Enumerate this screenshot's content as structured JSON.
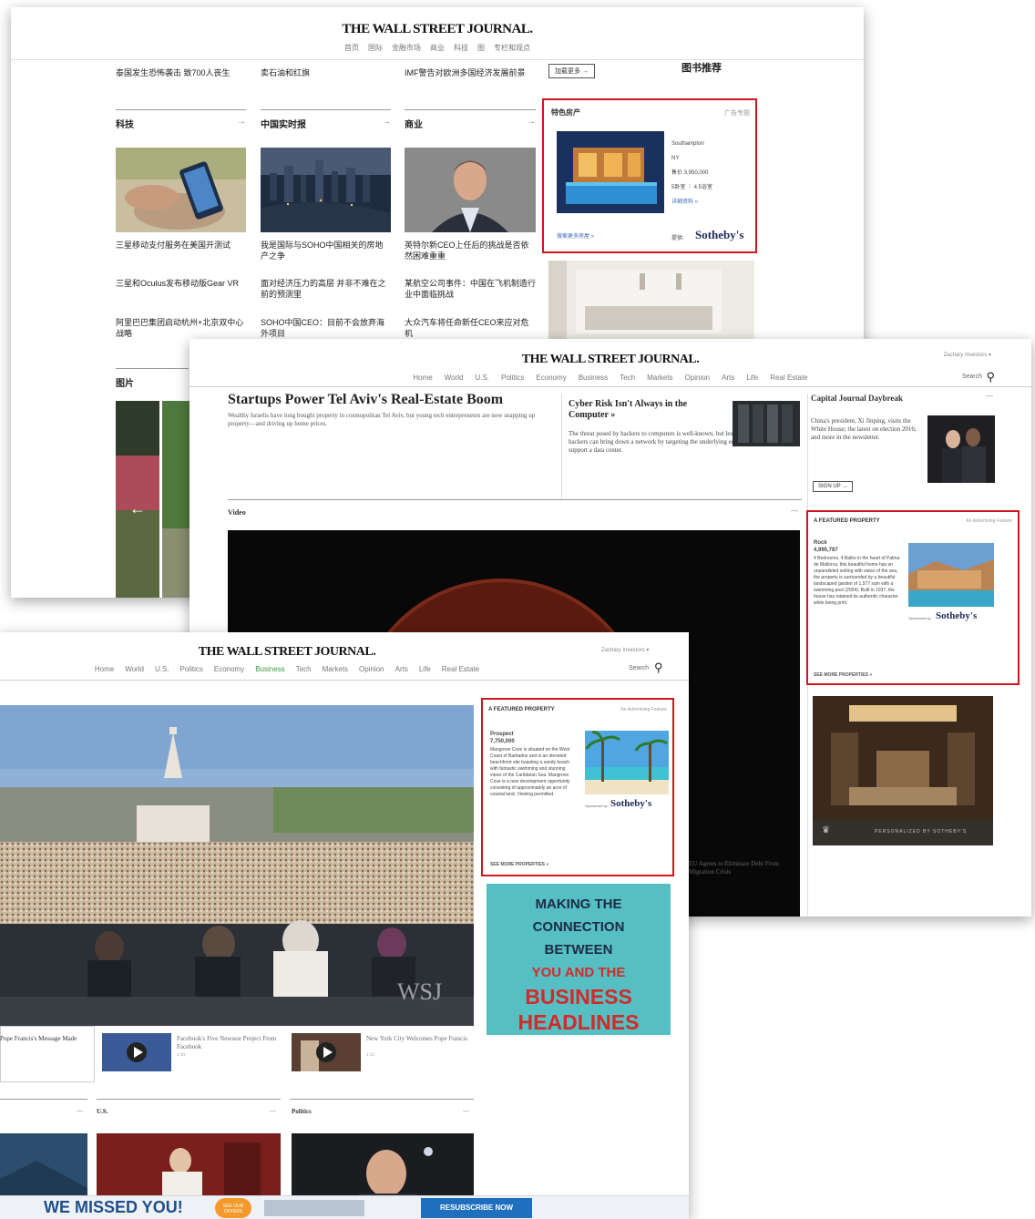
{
  "colors": {
    "accent_red": "#d0161e",
    "wsj_blue": "#3a6ab8",
    "ad_teal": "#56bfc3",
    "ad_red": "#d22a2a",
    "sothebys_navy": "#1b2a58"
  },
  "panel1": {
    "logo": "THE WALL STREET JOURNAL.",
    "nav": [
      "首页",
      "国际",
      "金融市场",
      "商业",
      "科技",
      "图",
      "专栏和观点"
    ],
    "top_snippets": [
      "泰国发生恐怖袭击 致700人丧生",
      "卖石油和红旗",
      "IMF警告对欧洲多国经济发展前景",
      "加载更多 →",
      "图书推荐"
    ],
    "columns": [
      {
        "head": "科技",
        "items": [
          "三星移动支付服务在美国开测试",
          "三星和Oculus发布移动版Gear VR",
          "阿里巴巴集团启动杭州+北京双中心战略"
        ]
      },
      {
        "head": "中国实时报",
        "items": [
          "我是国际与SOHO中国相关的房地产之争",
          "面对经济压力的高层 并非不难在之前的预测里",
          "SOHO中国CEO：目前不会放弃海外项目"
        ]
      },
      {
        "head": "商业",
        "items": [
          "英特尔新CEO上任后的挑战是否依然困难重重",
          "某航空公司事件：中国在飞机制造行业中面临挑战",
          "大众汽车将任命新任CEO来应对危机"
        ]
      }
    ],
    "photos_head": "图片",
    "featured": {
      "head": "特色房产",
      "tag": "广告专题",
      "city": "Southampton",
      "state": "NY",
      "price": "售价 3,950,000",
      "rooms": "5卧室 ｜ 4.5浴室",
      "details_link": "详细资料 »",
      "more_link": "搜索更多房屋 »",
      "agency_prefix": "提供:",
      "agency": "Sotheby's"
    }
  },
  "panel2": {
    "logo": "THE WALL STREET JOURNAL.",
    "account": "Zachary Investors ▾",
    "nav": [
      "Home",
      "World",
      "U.S.",
      "Politics",
      "Economy",
      "Business",
      "Tech",
      "Markets",
      "Opinion",
      "Arts",
      "Life",
      "Real Estate"
    ],
    "search": "Search",
    "headline": "Startups Power Tel Aviv's Real-Estate Boom",
    "deck": "Wealthy Israelis have long bought property in cosmopolitan Tel Aviv, but young tech entrepreneurs are now snapping up property—and driving up home prices.",
    "side_headline": "Cyber Risk Isn't Always in the Computer »",
    "side_deck": "The threat posed by hackers to computers is well-known, but less understood is how hackers can bring down a network by targeting the underlying equipment that support a data center.",
    "video_label": "Video",
    "capital_journal": {
      "head": "Capital Journal Daybreak",
      "text": "China's president, Xi Jinping, visits the White House; the latest on election 2016; and more in the newsletter.",
      "signup": "SIGN UP →"
    },
    "featured": {
      "head": "A FEATURED PROPERTY",
      "tag": "An Advertising Feature",
      "place": "Rock",
      "price": "4,995,787",
      "desc": "4 Bedrooms, 4 Baths in the heart of Palma de Mallorca, this beautiful home has an unparalleled setting with views of the sea, the property is surrounded by a beautiful landscaped garden of 1,577 sqm with a swimming pool (2004). Built in 1937, the house has retained its authentic character while being prim.",
      "more": "SEE MORE PROPERTIES »",
      "sponsor": "Sponsored by",
      "agency": "Sotheby's"
    },
    "ad_caption": "PERSONALIZED BY SOTHEBY'S",
    "video_caption": "EU Agrees to Eliminate Debt From Migration Crisis"
  },
  "panel3": {
    "logo": "THE WALL STREET JOURNAL.",
    "account": "Zachary Investors ▾",
    "nav": [
      "Home",
      "World",
      "U.S.",
      "Politics",
      "Economy",
      "Business",
      "Tech",
      "Markets",
      "Opinion",
      "Arts",
      "Life",
      "Real Estate"
    ],
    "search": "Search",
    "watermark": "WSJ",
    "featured": {
      "head": "A FEATURED PROPERTY",
      "tag": "An Advertising Feature",
      "place": "Prospect",
      "price": "7,750,000",
      "desc": "Mangrove Cove is situated on the West Coast of Barbados and is an elevated beachfront site boasting a sandy beach with fantastic swimming and stunning views of the Caribbean Sea. Mangrove Cove is a new development opportunity consisting of approximately an acre of coastal land. Viewing permitted.",
      "more": "SEE MORE PROPERTIES »",
      "sponsor": "Sponsored by",
      "agency": "Sotheby's"
    },
    "ad_lines": [
      "MAKING THE",
      "CONNECTION",
      "BETWEEN",
      "YOU AND THE"
    ],
    "ad_big": [
      "BUSINESS",
      "HEADLINES"
    ],
    "thumbs": [
      {
        "text": "Pope Francis's Message Made"
      },
      {
        "text": "Facebook's Five Newsest Project From Facebook",
        "time": "2:10"
      },
      {
        "text": "New York City Welcomes Pope Francis",
        "time": "1:13"
      }
    ],
    "sections": [
      "",
      "U.S.",
      "Politics"
    ],
    "banner": {
      "text": "WE MISSED YOU!",
      "badge": "SEE OUR OFFERS",
      "cta": "RESUBSCRIBE NOW"
    }
  }
}
